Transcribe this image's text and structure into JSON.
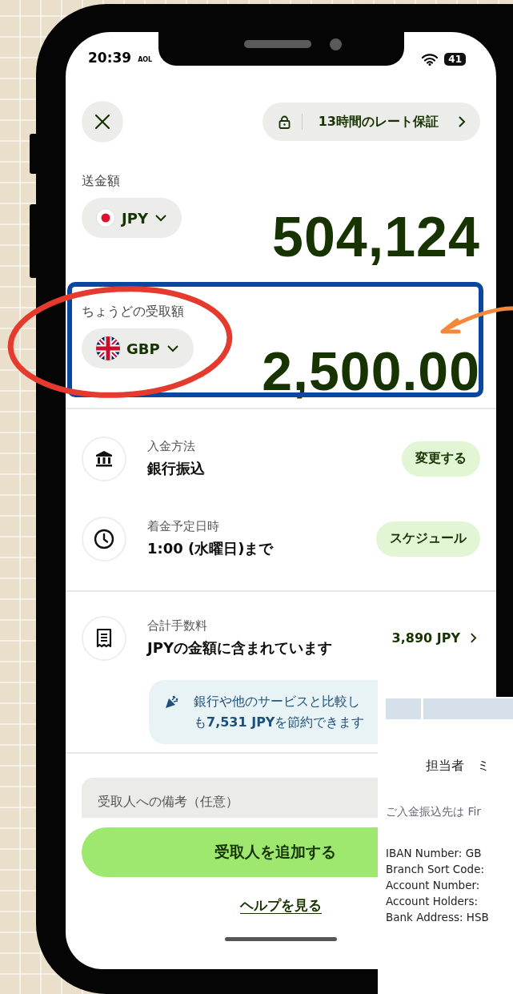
{
  "status_bar": {
    "time": "20:39",
    "carrier": "AOL",
    "battery": "41"
  },
  "header": {
    "rate_guarantee": "13時間のレート保証"
  },
  "send": {
    "label": "送金額",
    "kind": "japan",
    "currency": "JPY",
    "amount": "504,124"
  },
  "receive": {
    "label": "ちょうどの受取額",
    "kind": "uk",
    "currency": "GBP",
    "amount": "2,500.00"
  },
  "details": [
    {
      "kind": "bank",
      "label": "入金方法",
      "value": "銀行振込",
      "action": "変更する"
    },
    {
      "kind": "clock",
      "label": "着金予定日時",
      "value": "1:00 (水曜日)まで",
      "action": "スケジュール"
    },
    {
      "kind": "receipt",
      "label": "合計手数料",
      "value": "JPYの金額に含まれています",
      "amount": "3,890 JPY"
    }
  ],
  "savings": {
    "lines": [
      "銀行や他のサービスと比較し",
      "も**7,531 JPY**を節約できます"
    ]
  },
  "note_field": {
    "placeholder": "受取人への備考（任意）"
  },
  "primary_button": "受取人を追加する",
  "help_link": "ヘルプを見る",
  "overlay_document": {
    "title": "担当者　ミ",
    "intro": "ご入金振込先は Fir",
    "lines": [
      "IBAN Number:  GB",
      "Branch Sort Code:",
      "Account Number:",
      "Account Holders:",
      "Bank Address: HSB"
    ]
  }
}
